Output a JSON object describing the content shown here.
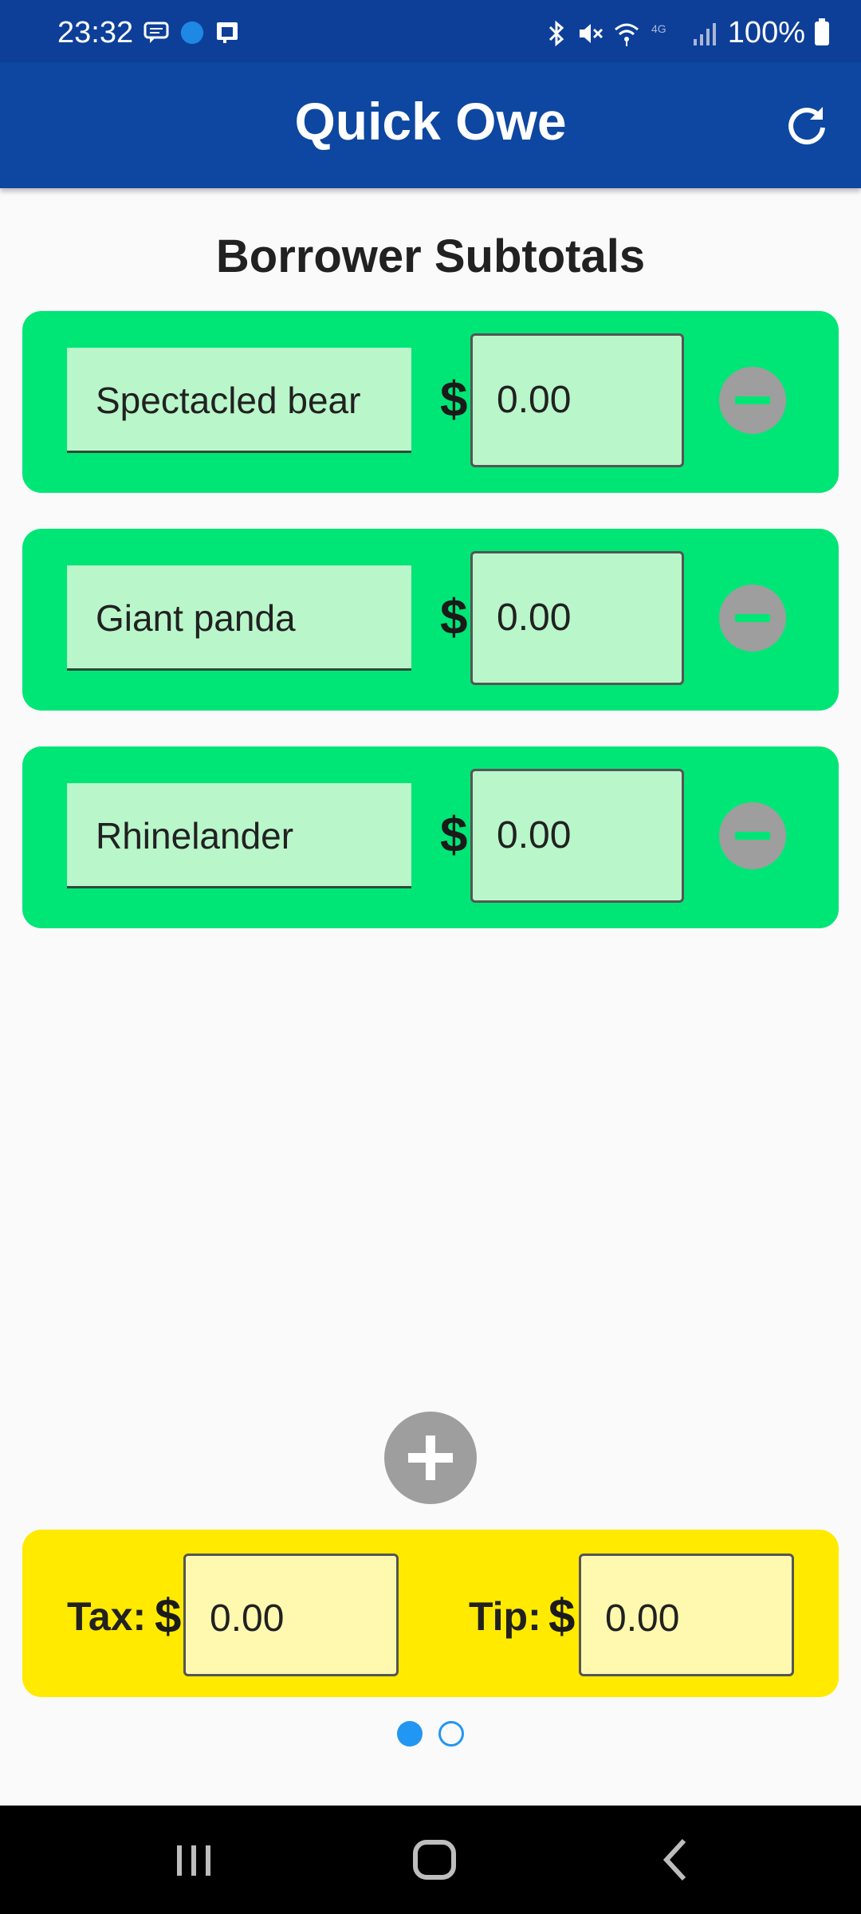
{
  "status_bar": {
    "time": "23:32",
    "battery": "100%",
    "left_icons": [
      "message-icon",
      "usa-today-icon",
      "cast-icon"
    ],
    "right_icons": [
      "bluetooth-icon",
      "mute-icon",
      "wifi-icon",
      "lte-icon",
      "signal-icon",
      "battery-icon"
    ]
  },
  "app_bar": {
    "title": "Quick Owe",
    "refresh_icon": "refresh-icon"
  },
  "section_title": "Borrower Subtotals",
  "borrowers": [
    {
      "name": "Spectacled bear",
      "currency": "$",
      "amount": "0.00"
    },
    {
      "name": "Giant panda",
      "currency": "$",
      "amount": "0.00"
    },
    {
      "name": "Rhinelander",
      "currency": "$",
      "amount": "0.00"
    }
  ],
  "tax_tip": {
    "tax_label": "Tax:",
    "tax_currency": "$",
    "tax_value": "0.00",
    "tip_label": "Tip:",
    "tip_currency": "$",
    "tip_value": "0.00"
  },
  "pager": {
    "total": 2,
    "active": 1
  },
  "colors": {
    "app_bar": "#0d47a1",
    "status_bar": "#0d3f99",
    "card": "#00e676",
    "card_field": "#b9f6ca",
    "tax_card": "#ffea00",
    "tax_field": "#fff9b0",
    "button_grey": "#9e9e9e",
    "dot_active": "#2196f3"
  }
}
